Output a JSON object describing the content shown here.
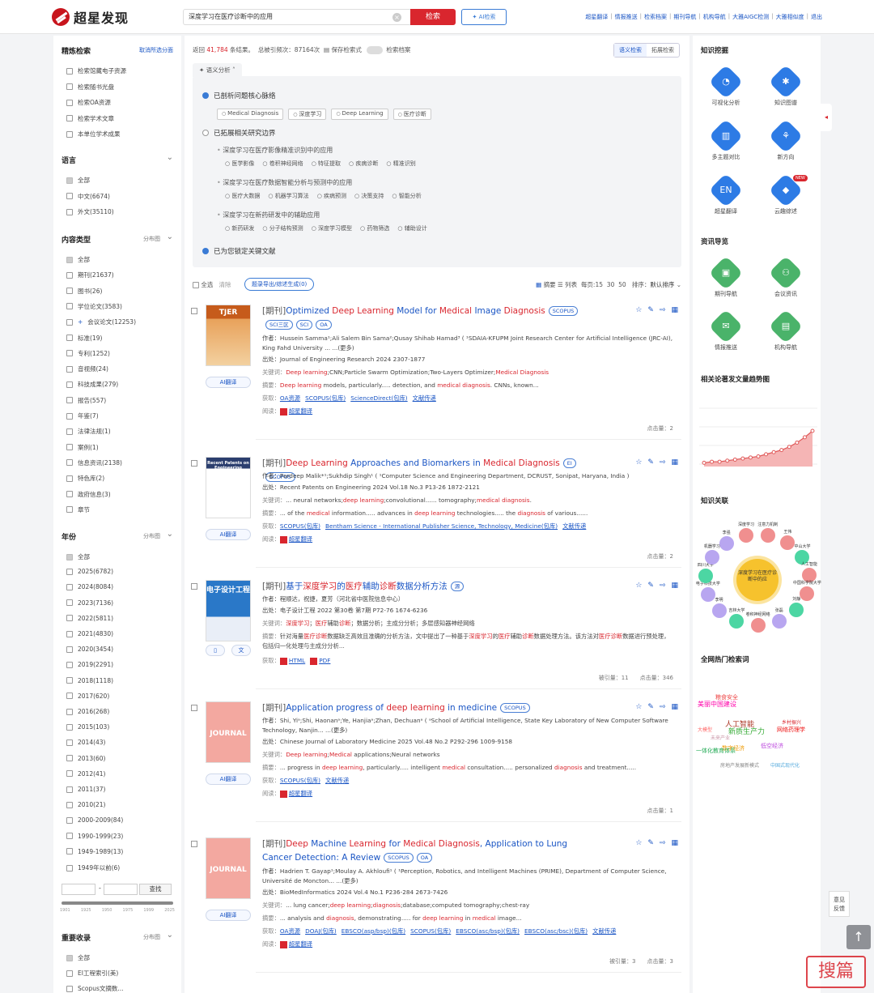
{
  "app": {
    "name": "超星发现"
  },
  "search": {
    "query": "深度学习在医疗诊断中的应用",
    "search_label": "检索",
    "ai_label": "AI检索",
    "clear": "×"
  },
  "toplinks": [
    "超星翻译",
    "情报推送",
    "检索档案",
    "期刊导航",
    "机构导航",
    "大雅AIGC检测",
    "大雅相似度",
    "退出"
  ],
  "left": {
    "refine": {
      "title": "精炼检索",
      "action": "取消所选分面",
      "items": [
        "检索馆藏电子资源",
        "检索随书光盘",
        "检索OA资源",
        "检索学术文章",
        "本单位学术成果"
      ]
    },
    "language": {
      "title": "语言",
      "items": [
        "全部",
        "中文(6674)",
        "外文(35110)"
      ]
    },
    "content_type": {
      "title": "内容类型",
      "action": "分布图",
      "items": [
        "全部",
        "期刊(21637)",
        "图书(26)",
        "学位论文(3583)",
        "会议论文(12253)",
        "标准(19)",
        "专利(1252)",
        "音视频(24)",
        "科技成果(279)",
        "报告(557)",
        "年鉴(7)",
        "法律法规(1)",
        "案例(1)",
        "信息资讯(2138)",
        "特色库(2)",
        "政府信息(3)",
        "章节"
      ]
    },
    "year": {
      "title": "年份",
      "action": "分布图",
      "items": [
        "全部",
        "2025(6782)",
        "2024(8084)",
        "2023(7136)",
        "2022(5811)",
        "2021(4830)",
        "2020(3454)",
        "2019(2291)",
        "2018(1118)",
        "2017(620)",
        "2016(268)",
        "2015(103)",
        "2014(43)",
        "2013(60)",
        "2012(41)",
        "2011(37)",
        "2010(21)",
        "2000-2009(84)",
        "1990-1999(23)",
        "1949-1989(13)",
        "1949年以前(6)"
      ],
      "find_label": "查找",
      "slider_ticks": [
        "1901",
        "1925",
        "1950",
        "1975",
        "1999",
        "2025"
      ]
    },
    "important": {
      "title": "重要收录",
      "action": "分布图",
      "items": [
        "全部",
        "EI工程索引(美)",
        "Scopus文摘数..."
      ]
    }
  },
  "stats": {
    "prefix": "返回",
    "count": "41,784",
    "suffix": "条结果。",
    "freq": "总被引频次：87164次",
    "save": "保存检索式",
    "archive": "检索档案"
  },
  "view_tabs": [
    "语义检索",
    "拓展检索"
  ],
  "semantic": {
    "tab": "语义分析",
    "core": "已剖析问题核心脉络",
    "core_chips": [
      "Medical Diagnosis",
      "深度学习",
      "Deep Learning",
      "医疗诊断"
    ],
    "expand": "已拓展相关研究边界",
    "subs": [
      {
        "q": "深度学习在医疗影像精准识别中的应用",
        "chips": [
          "医学影像",
          "卷积神经网络",
          "特征提取",
          "疾病诊断",
          "精准识别"
        ]
      },
      {
        "q": "深度学习在医疗数据智能分析与预测中的应用",
        "chips": [
          "医疗大数据",
          "机器学习算法",
          "疾病预测",
          "决策支持",
          "智能分析"
        ]
      },
      {
        "q": "深度学习在新药研发中的辅助应用",
        "chips": [
          "新药研发",
          "分子结构预测",
          "深度学习模型",
          "药物筛选",
          "辅助设计"
        ]
      }
    ],
    "locked": "已为您锁定关键文献"
  },
  "toolbar": {
    "select_all": "全选",
    "clear": "清除",
    "export": "题录导出/综述生成(0)",
    "view_abs": "摘要",
    "view_list": "列表",
    "per_page": "每页:15",
    "p30": "30",
    "p50": "50",
    "sort_label": "排序：",
    "sort_val": "默认排序"
  },
  "results": [
    {
      "tag": "[期刊]",
      "title_parts": [
        [
          "Optimized ",
          0
        ],
        [
          "Deep Learning",
          1
        ],
        [
          " Model for ",
          0
        ],
        [
          "Medical",
          1
        ],
        [
          " Image ",
          0
        ],
        [
          "Diagnosis",
          1
        ]
      ],
      "badges": [
        "SCOPUS",
        "SCI三区",
        "SCI",
        "OA"
      ],
      "cover_text": "TJER",
      "author": "作者：Hussein Samma¹;Ali Salem Bin Sama²;Qusay Shihab Hamad³ ( ¹SDAIA-KFUPM Joint Research Center for Artificial Intelligence (JRC-AI), King Fahd University ... ...(更多)",
      "source": "出处：Journal of Engineering Research 2024  2307-1877",
      "keywords": [
        [
          "关键词：",
          2
        ],
        [
          "Deep learning",
          1
        ],
        [
          ";CNN;Particle Swarm Optimization;Two-Layers Optimizer;",
          0
        ],
        [
          "Medical Diagnosis",
          1
        ]
      ],
      "abstract": [
        [
          "摘要：",
          2
        ],
        [
          "Deep learning",
          1
        ],
        [
          " models, particularly..... detection, and ",
          0
        ],
        [
          "medical diagnosis",
          1
        ],
        [
          ". CNNs, known...",
          0
        ]
      ],
      "get_label": "获取：",
      "links": [
        "OA资源",
        "SCOPUS(包库)",
        "ScienceDirect(包库)",
        "文献传递"
      ],
      "read_label": "阅读：",
      "read": "超星翻译",
      "ai": "AI翻译",
      "clicks": "点击量：2",
      "cited": ""
    },
    {
      "tag": "[期刊]",
      "title_parts": [
        [
          "Deep Learning",
          1
        ],
        [
          " Approaches and Biomarkers in ",
          0
        ],
        [
          "Medical Diagnosis",
          1
        ]
      ],
      "badges": [
        "EI",
        "SCOPUS"
      ],
      "cover_text": "Recent Patents on Engineering",
      "author": "作者：Pardeep Malik*¹;Sukhdip Singh¹ ( ¹Computer Science and Engineering Department, DCRUST, Sonipat, Haryana, India )",
      "source": "出处：Recent Patents on Engineering 2024 Vol.18 No.3 P13-26  1872-2121",
      "keywords": [
        [
          "关键词：",
          2
        ],
        [
          "... neural networks;",
          0
        ],
        [
          "deep learning",
          1
        ],
        [
          ";convolutional...... tomography;",
          0
        ],
        [
          "medical diagnosis",
          1
        ],
        [
          ".",
          0
        ]
      ],
      "abstract": [
        [
          "摘要：",
          2
        ],
        [
          "... of the ",
          0
        ],
        [
          "medical",
          1
        ],
        [
          " information..... advances in ",
          0
        ],
        [
          "deep learning",
          1
        ],
        [
          " technologies..... the ",
          0
        ],
        [
          "diagnosis",
          1
        ],
        [
          " of various......",
          0
        ]
      ],
      "get_label": "获取：",
      "links": [
        "SCOPUS(包库)",
        "Bentham Science - International Publisher Science, Technology, Medicine(包库)",
        "文献传递"
      ],
      "read_label": "阅读：",
      "read": "超星翻译",
      "ai": "AI翻译",
      "clicks": "点击量：2",
      "cited": ""
    },
    {
      "tag": "[期刊]",
      "title_parts": [
        [
          "基于",
          0
        ],
        [
          "深度学习",
          1
        ],
        [
          "的",
          0
        ],
        [
          "医疗",
          1
        ],
        [
          "辅助",
          0
        ],
        [
          "诊断",
          1
        ],
        [
          "数据分析方法",
          0
        ]
      ],
      "badges": [
        "源"
      ],
      "cover_text": "电子设计工程",
      "author": "作者：程顺达，祝捷，夏芳（河北省中医院信息中心）",
      "source": "出处：电子设计工程 2022 第30卷 第7期 P72-76  1674-6236",
      "keywords": [
        [
          "关键词：",
          2
        ],
        [
          "深度学习",
          1
        ],
        [
          "；",
          0
        ],
        [
          "医疗",
          1
        ],
        [
          "辅助",
          0
        ],
        [
          "诊断",
          1
        ],
        [
          "；数据分析；主成分分析；多层感知器神经网络",
          0
        ]
      ],
      "abstract": [
        [
          "摘要：",
          2
        ],
        [
          "针对海量",
          0
        ],
        [
          "医疗诊断",
          1
        ],
        [
          "数据缺乏高效且准确的分析方法，文中提出了一种基于",
          0
        ],
        [
          "深度学习",
          1
        ],
        [
          "的",
          0
        ],
        [
          "医疗",
          1
        ],
        [
          "辅助",
          0
        ],
        [
          "诊断",
          1
        ],
        [
          "数据处理方法。该方法对",
          0
        ],
        [
          "医疗诊断",
          1
        ],
        [
          "数据进行预处理，包括归一化处理与主成分分析...",
          0
        ]
      ],
      "get_label": "获取：",
      "links": [
        "HTML",
        "PDF"
      ],
      "read_label": "",
      "read": "",
      "ai": "",
      "clicks": "点击量：346",
      "cited": "被引量：11"
    },
    {
      "tag": "[期刊]",
      "title_parts": [
        [
          "Application progress of ",
          0
        ],
        [
          "deep learning",
          1
        ],
        [
          " in medicine",
          0
        ]
      ],
      "badges": [
        "SCOPUS"
      ],
      "cover_text": "JOURNAL",
      "author": "作者：Shi, Yiᵃ;Shi, Haonanᵃ;Ye, Hanjiaᵃ;Zhan, Dechuanᵃ ( ᵃSchool of Artificial Intelligence, State Key Laboratory of New Computer Software Technology, Nanjin... ...(更多)",
      "source": "出处：Chinese Journal of Laboratory Medicine 2025 Vol.48 No.2 P292-296  1009-9158",
      "keywords": [
        [
          "关键词：",
          2
        ],
        [
          "Deep learning",
          1
        ],
        [
          ";",
          0
        ],
        [
          "Medical",
          1
        ],
        [
          " applications;Neural networks",
          0
        ]
      ],
      "abstract": [
        [
          "摘要：",
          2
        ],
        [
          "... progress in ",
          0
        ],
        [
          "deep learning",
          1
        ],
        [
          ", particularly..... intelligent ",
          0
        ],
        [
          "medical",
          1
        ],
        [
          " consultation..... personalized ",
          0
        ],
        [
          "diagnosis",
          1
        ],
        [
          " and treatment.....",
          0
        ]
      ],
      "get_label": "获取：",
      "links": [
        "SCOPUS(包库)",
        "文献传递"
      ],
      "read_label": "阅读：",
      "read": "超星翻译",
      "ai": "AI翻译",
      "clicks": "点击量：1",
      "cited": ""
    },
    {
      "tag": "[期刊]",
      "title_parts": [
        [
          "Deep",
          1
        ],
        [
          " Machine ",
          0
        ],
        [
          "Learning",
          1
        ],
        [
          " for ",
          0
        ],
        [
          "Medical Diagnosis",
          1
        ],
        [
          ", Application to Lung Cancer Detection: A Review",
          0
        ]
      ],
      "badges": [
        "SCOPUS",
        "OA"
      ],
      "cover_text": "JOURNAL",
      "author": "作者：Hadrien T. Gayap¹;Moulay A. Akhloufi¹ ( ¹Perception, Robotics, and Intelligent Machines (PRIME), Department of Computer Science, Université de Moncton... ...(更多)",
      "source": "出处：BioMedInformatics 2024 Vol.4 No.1 P236-284  2673-7426",
      "keywords": [
        [
          "关键词：",
          2
        ],
        [
          "... lung cancer;",
          0
        ],
        [
          "deep learning",
          1
        ],
        [
          ";",
          0
        ],
        [
          "diagnosis",
          1
        ],
        [
          ";database;computed tomography;chest-ray",
          0
        ]
      ],
      "abstract": [
        [
          "摘要：",
          2
        ],
        [
          "... analysis and ",
          0
        ],
        [
          "diagnosis",
          1
        ],
        [
          ", demonstrating..... for ",
          0
        ],
        [
          "deep learning",
          1
        ],
        [
          " in ",
          0
        ],
        [
          "medical",
          1
        ],
        [
          " image...",
          0
        ]
      ],
      "get_label": "获取：",
      "links": [
        "OA资源",
        "DOAJ(包库)",
        "EBSCO(asp/bsp)(包库)",
        "SCOPUS(包库)",
        "EBSCO(asc/bsp)(包库)",
        "EBSCO(asc/bsc)(包库)",
        "文献传递"
      ],
      "read_label": "阅读：",
      "read": "超星翻译",
      "ai": "AI翻译",
      "clicks": "点击量：3",
      "cited": "被引量：3"
    }
  ],
  "right": {
    "mining_title": "知识挖掘",
    "tools": [
      "可视化分析",
      "知识图谱",
      "多主题对比",
      "新方向",
      "超星翻译",
      "云趣综述"
    ],
    "new_badge": "NEW",
    "info_title": "资讯导览",
    "info_tools": [
      "期刊导航",
      "会议资讯",
      "情报推送",
      "机构导航"
    ],
    "trend_title": "相关论著发文量趋势图",
    "trend_values": [
      2,
      3,
      3,
      4,
      5,
      6,
      7,
      8,
      10,
      12,
      14,
      17,
      21,
      26,
      32
    ],
    "assoc_title": "知识关联",
    "assoc_center": "深度学习在医疗诊断中的应",
    "assoc_nodes": [
      "注意力机制",
      "王伟",
      "中山大学",
      "人工智能",
      "中国科学院大学",
      "刘静",
      "张磊",
      "卷积神经网络",
      "吉林大学",
      "李明",
      "电子科技大学",
      "四川大学",
      "机器学习",
      "李强",
      "深度学习"
    ],
    "hot_title": "全网热门检索词",
    "hot_words": [
      "美丽中国建设",
      "粮食安全",
      "人工智能",
      "新质生产力",
      "乡村振兴",
      "网络药理学",
      "大模型",
      "未来产业",
      "数字经济",
      "低空经济",
      "一体化教育体系",
      "房地产发展新模式",
      "中国式现代化"
    ]
  },
  "side": {
    "handle": "◂",
    "feedback": [
      "意见",
      "反馈"
    ],
    "top": "↑",
    "stamp": "搜篇"
  },
  "colors": {
    "brand": "#d9262e",
    "link": "#1a55c4",
    "highlight": "#d9262e"
  }
}
